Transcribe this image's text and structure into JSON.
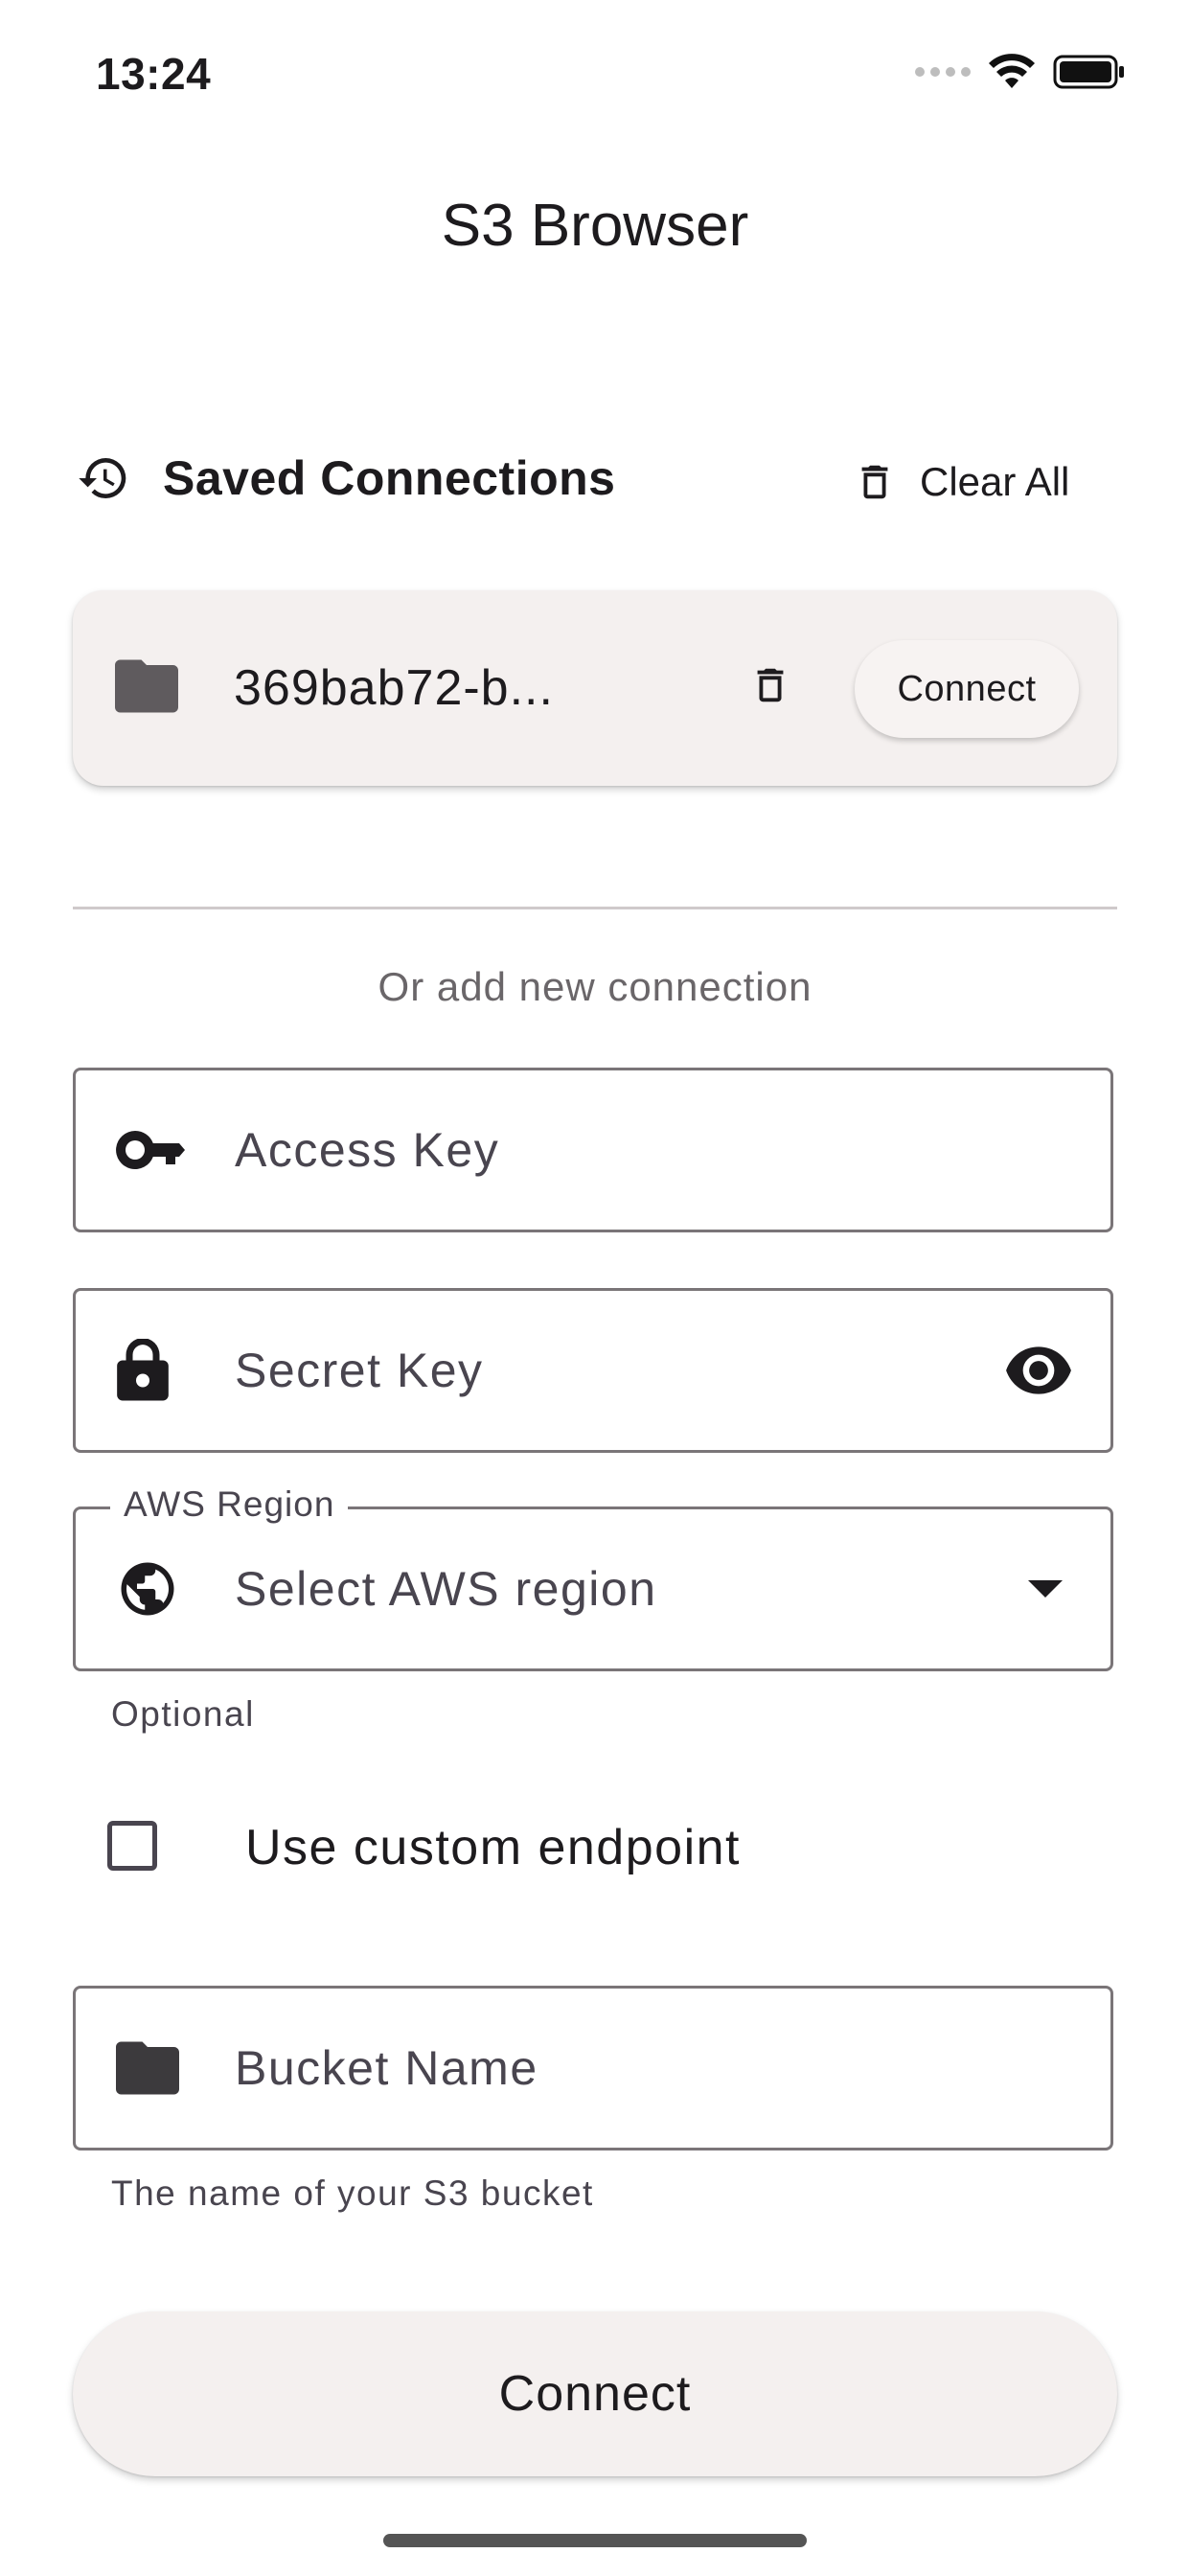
{
  "status_bar": {
    "time": "13:24"
  },
  "app_bar": {
    "title": "S3 Browser"
  },
  "saved_connections": {
    "title": "Saved Connections",
    "clear_all_label": "Clear All",
    "items": [
      {
        "name": "369bab72-b...",
        "connect_label": "Connect"
      }
    ]
  },
  "new_connection": {
    "divider_text": "Or add new connection",
    "access_key": {
      "placeholder": "Access Key",
      "value": ""
    },
    "secret_key": {
      "placeholder": "Secret Key",
      "value": ""
    },
    "region": {
      "label": "AWS Region",
      "placeholder": "Select AWS region",
      "helper": "Optional"
    },
    "custom_endpoint": {
      "label": "Use custom endpoint",
      "checked": false
    },
    "bucket_name": {
      "placeholder": "Bucket Name",
      "value": "",
      "helper": "The name of your S3 bucket"
    },
    "connect_label": "Connect"
  },
  "icons": {
    "history": "history-icon",
    "delete": "delete-icon",
    "folder": "folder-icon",
    "key": "key-icon",
    "lock": "lock-icon",
    "visibility": "eye-icon",
    "globe": "globe-icon",
    "dropdown": "dropdown-arrow-icon"
  }
}
